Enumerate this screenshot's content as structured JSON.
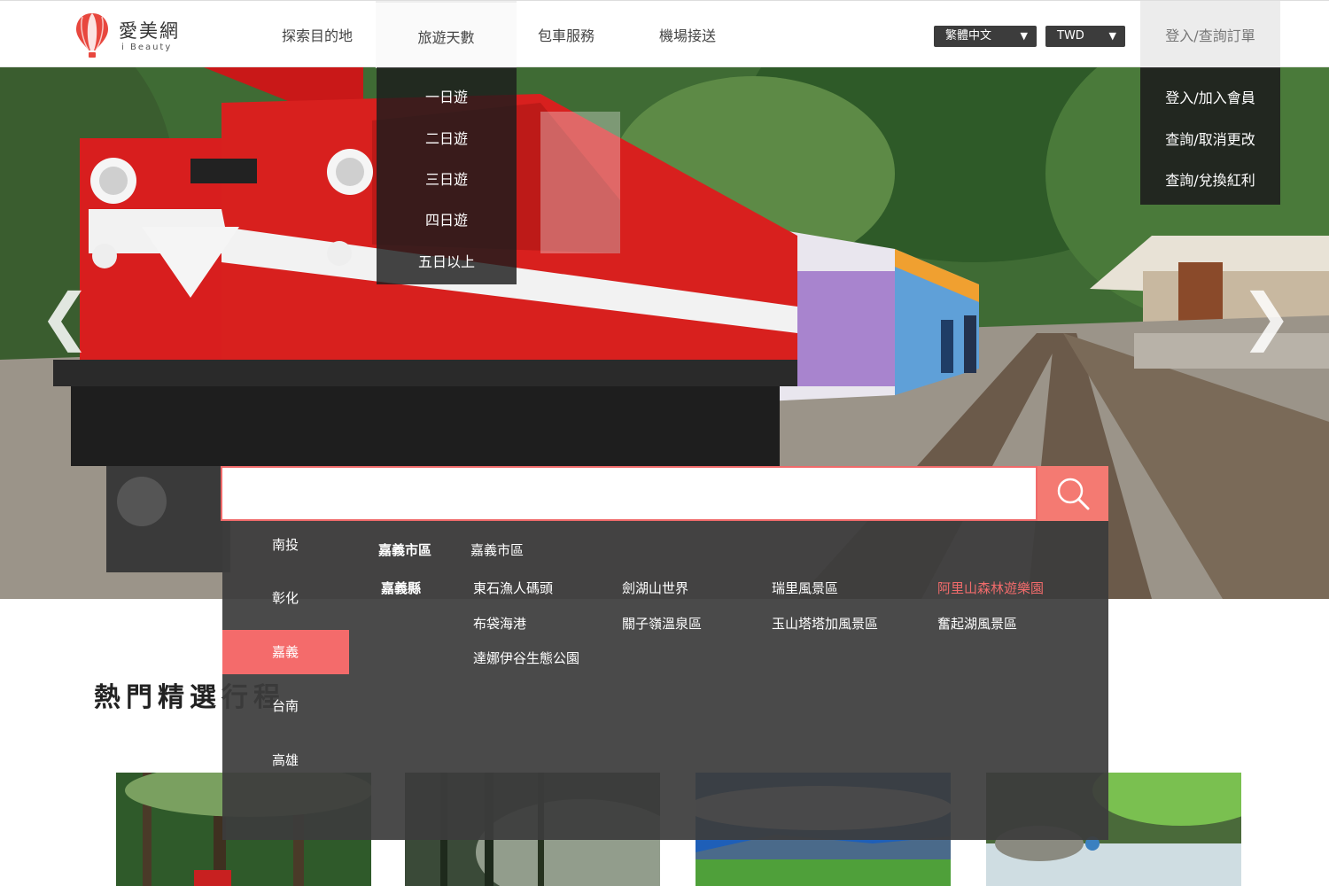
{
  "brand": {
    "name": "愛美網",
    "subtitle": "i Beauty"
  },
  "nav": {
    "items": [
      {
        "label": "探索目的地"
      },
      {
        "label": "旅遊天數"
      },
      {
        "label": "包車服務"
      },
      {
        "label": "機場接送"
      }
    ]
  },
  "language_select": {
    "value": "繁體中文",
    "arrow": "▼"
  },
  "currency_select": {
    "value": "TWD",
    "arrow": "▼"
  },
  "login_tab": {
    "label": "登入/查詢訂單"
  },
  "days_menu": {
    "items": [
      "一日遊",
      "二日遊",
      "三日遊",
      "四日遊",
      "五日以上"
    ]
  },
  "login_menu": {
    "items": [
      "登入/加入會員",
      "查詢/取消更改",
      "查詢/兌換紅利"
    ]
  },
  "hero": {
    "prev_arrow": "❮",
    "next_arrow": "❯"
  },
  "search": {
    "value": "",
    "placeholder": ""
  },
  "regions": {
    "items": [
      "南投",
      "彰化",
      "嘉義",
      "台南",
      "高雄"
    ],
    "active": "嘉義"
  },
  "areas": {
    "city": {
      "label": "嘉義市區",
      "spots": [
        "嘉義市區"
      ]
    },
    "county": {
      "label": "嘉義縣",
      "spots": [
        "東石漁人碼頭",
        "劍湖山世界",
        "瑞里風景區",
        "阿里山森林遊樂園",
        "布袋海港",
        "關子嶺溫泉區",
        "玉山塔塔加風景區",
        "奮起湖風景區",
        "達娜伊谷生態公園"
      ],
      "highlighted": "阿里山森林遊樂園"
    }
  },
  "section": {
    "title": "熱門精選行程"
  },
  "colors": {
    "accent": "#f47a72",
    "dark_select": "#3c3c3c",
    "panel": "#3c3c3c"
  }
}
